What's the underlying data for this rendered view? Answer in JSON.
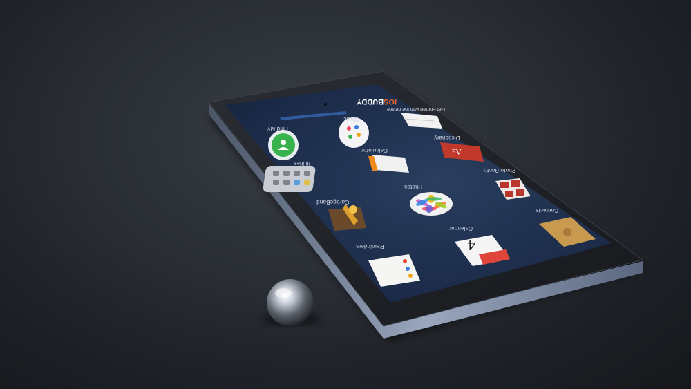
{
  "brand": {
    "part1": "IOS",
    "part2": "BUDDY",
    "color1": "#e8662a",
    "color2": "#ffffff"
  },
  "status_bar": {
    "text": "Get Started with the device"
  },
  "apps": [
    {
      "id": "find-my",
      "label": "Find My",
      "icon": "find-my-icon"
    },
    {
      "id": "music",
      "label": "Music",
      "icon": "music-icon"
    },
    {
      "id": "files",
      "label": "",
      "icon": "document-icon"
    },
    {
      "id": "utilities",
      "label": "Utilities",
      "icon": "folder-grid-icon"
    },
    {
      "id": "calculator",
      "label": "Calculator",
      "icon": "calculator-icon"
    },
    {
      "id": "dictionary",
      "label": "Dictionary",
      "icon": "dictionary-icon"
    },
    {
      "id": "garageband",
      "label": "GarageBand",
      "icon": "garageband-icon"
    },
    {
      "id": "photos",
      "label": "Photos",
      "icon": "photos-icon"
    },
    {
      "id": "photo-booth",
      "label": "Photo Booth",
      "icon": "photo-booth-icon"
    },
    {
      "id": "reminders",
      "label": "Reminders",
      "icon": "reminders-icon"
    },
    {
      "id": "calendar",
      "label": "Calendar",
      "icon": "calendar-icon"
    },
    {
      "id": "contacts",
      "label": "Contacts",
      "icon": "contacts-icon"
    }
  ],
  "calendar_day": "4",
  "colors": {
    "screen": "#1a2a4a",
    "bezel": "#1e2026",
    "table": "#2a2e35"
  }
}
